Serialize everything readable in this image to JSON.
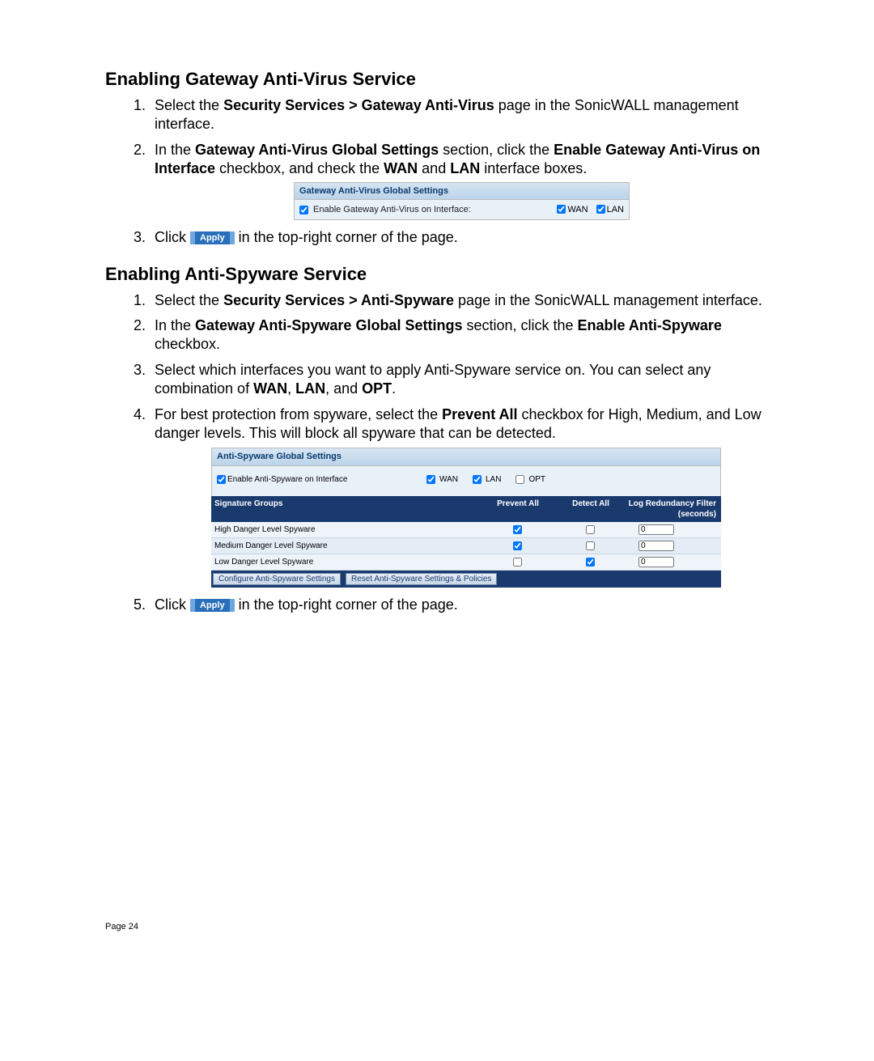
{
  "section1": {
    "title": "Enabling Gateway Anti-Virus Service",
    "step1_pre": "Select the ",
    "step1_b": "Security Services > Gateway Anti-Virus",
    "step1_post": " page in the SonicWALL management interface.",
    "step2_pre": "In the ",
    "step2_b1": "Gateway Anti-Virus Global Settings",
    "step2_mid1": " section, click the ",
    "step2_b2": "Enable Gateway Anti-Virus on Interface",
    "step2_mid2": " checkbox, and check the ",
    "step2_b3": "WAN",
    "step2_mid3": " and ",
    "step2_b4": "LAN",
    "step2_post": " interface boxes.",
    "step3_pre": "Click ",
    "step3_post": " in the top-right corner of the page."
  },
  "gav_panel": {
    "header": "Gateway Anti-Virus Global Settings",
    "enable_label": "Enable Gateway Anti-Virus on Interface:",
    "wan": "WAN",
    "lan": "LAN"
  },
  "apply_label": "Apply",
  "section2": {
    "title": "Enabling Anti-Spyware Service",
    "step1_pre": "Select the ",
    "step1_b": "Security Services > Anti-Spyware",
    "step1_post": " page in the SonicWALL management interface.",
    "step2_pre": "In the ",
    "step2_b1": "Gateway Anti-Spyware Global Settings",
    "step2_mid1": " section, click the ",
    "step2_b2": "Enable Anti-Spyware",
    "step2_post": " checkbox.",
    "step3_pre": "Select which interfaces you want to apply Anti-Spyware service on. You can select any combination of ",
    "step3_b1": "WAN",
    "step3_c1": ", ",
    "step3_b2": "LAN",
    "step3_c2": ", and ",
    "step3_b3": "OPT",
    "step3_post": ".",
    "step4_pre": "For best protection from spyware, select the ",
    "step4_b": "Prevent All",
    "step4_post": " checkbox for High, Medium, and Low danger levels. This will block all spyware that can be detected.",
    "step5_pre": "Click ",
    "step5_post": " in the top-right corner of the page."
  },
  "as_panel": {
    "header": "Anti-Spyware Global Settings",
    "enable_label": "Enable Anti-Spyware on Interface",
    "wan": "WAN",
    "lan": "LAN",
    "opt": "OPT",
    "cols": {
      "sig": "Signature Groups",
      "pa": "Prevent All",
      "da": "Detect All",
      "log": "Log Redundancy Filter (seconds)"
    },
    "rows": [
      {
        "name": "High Danger Level Spyware",
        "prevent": true,
        "detect": false,
        "log": "0"
      },
      {
        "name": "Medium Danger Level Spyware",
        "prevent": true,
        "detect": false,
        "log": "0"
      },
      {
        "name": "Low Danger Level Spyware",
        "prevent": false,
        "detect": true,
        "log": "0"
      }
    ],
    "btn_configure": "Configure Anti-Spyware Settings",
    "btn_reset": "Reset Anti-Spyware Settings & Policies"
  },
  "page_label": "Page 24"
}
